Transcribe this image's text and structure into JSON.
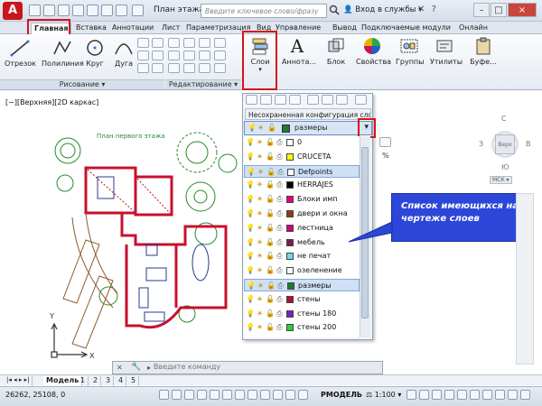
{
  "titlebar": {
    "logo": "A",
    "doc_title": "План этажа...",
    "search_placeholder": "Введите ключевое слово/фразу",
    "login": "Вход в службы",
    "minimize": "–",
    "maximize": "□",
    "close": "×"
  },
  "tabs": [
    "Главная",
    "Вставка",
    "Аннотации",
    "Лист",
    "Параметризация",
    "Вид",
    "Управление",
    "Вывод",
    "Подключаемые модули",
    "Онлайн"
  ],
  "ribbon": {
    "draw_buttons": [
      "Отрезок",
      "Полилиния",
      "Круг",
      "Дуга"
    ],
    "draw_panel": "Рисование",
    "edit_panel": "Редактирование",
    "layers_button": "Слои",
    "big_buttons": [
      "Аннота...",
      "Блок",
      "Свойства",
      "Группы",
      "Утилиты",
      "Буфе..."
    ]
  },
  "viewport": {
    "label": "[−][Верхняя][2D каркас]",
    "plan_title": "План первого этажа"
  },
  "layers": {
    "config": "Несохраненная конфигурация сло",
    "current": "размеры",
    "current_color": "#1e7a2e",
    "items": [
      {
        "name": "0",
        "color": "#ffffff"
      },
      {
        "name": "CRUCETA",
        "color": "#ffff00"
      },
      {
        "name": "Defpoints",
        "color": "#ffffff",
        "selected": true
      },
      {
        "name": "HERRAJES",
        "color": "#000000"
      },
      {
        "name": "Блоки имп",
        "color": "#e6007e"
      },
      {
        "name": "двери и окна",
        "color": "#8b3a1a"
      },
      {
        "name": "лестница",
        "color": "#d0007a"
      },
      {
        "name": "мебель",
        "color": "#7a1d4a"
      },
      {
        "name": "не печат",
        "color": "#6fd6e8"
      },
      {
        "name": "озеленение",
        "color": "#ffffff"
      },
      {
        "name": "размеры",
        "color": "#1e7a2e",
        "selected": true
      },
      {
        "name": "стены",
        "color": "#b0102a"
      },
      {
        "name": "стены 180",
        "color": "#7a1fb5"
      },
      {
        "name": "стены 200",
        "color": "#2ecc40"
      }
    ]
  },
  "callout": "Список имеющихся на чертеже слоев",
  "viewcube": {
    "top": "C",
    "left": "З",
    "right": "В",
    "bottom": "Ю",
    "face": "Верх",
    "wcs": "МСК"
  },
  "layout_tabs": [
    "Модель",
    "1",
    "2",
    "3",
    "4",
    "5"
  ],
  "command_placeholder": "Введите команду",
  "status": {
    "coords": "26262, 25108, 0",
    "model": "РМОДЕЛЬ",
    "scale": "1:100"
  },
  "colors": {
    "highlight": "#d4141c",
    "callout_bg": "#2c47d8",
    "walls": "#c8102e",
    "greenery": "#2a8a2a"
  }
}
